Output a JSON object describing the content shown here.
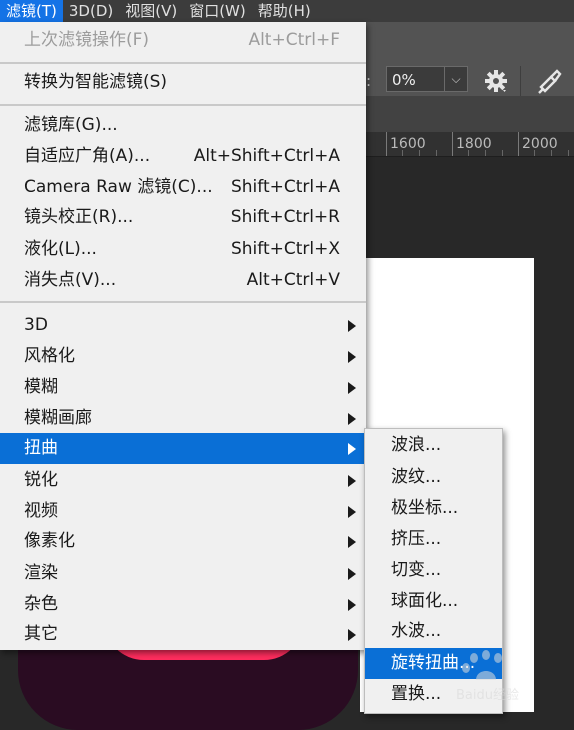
{
  "menubar": {
    "items": [
      {
        "label": "滤镜(T)"
      },
      {
        "label": "3D(D)"
      },
      {
        "label": "视图(V)"
      },
      {
        "label": "窗口(W)"
      },
      {
        "label": "帮助(H)"
      }
    ]
  },
  "options": {
    "opacity_label": ":",
    "opacity_value": "0%"
  },
  "ruler": {
    "labels": [
      "1600",
      "1800",
      "2000"
    ]
  },
  "filter_menu": {
    "last_filter": {
      "label": "上次滤镜操作(F)",
      "shortcut": "Alt+Ctrl+F"
    },
    "smart": {
      "label": "转换为智能滤镜(S)"
    },
    "gallery": {
      "label": "滤镜库(G)..."
    },
    "adaptive_wide": {
      "label": "自适应广角(A)...",
      "shortcut": "Alt+Shift+Ctrl+A"
    },
    "camera_raw": {
      "label": "Camera Raw 滤镜(C)...",
      "shortcut": "Shift+Ctrl+A"
    },
    "lens_correction": {
      "label": "镜头校正(R)...",
      "shortcut": "Shift+Ctrl+R"
    },
    "liquify": {
      "label": "液化(L)...",
      "shortcut": "Shift+Ctrl+X"
    },
    "vanishing_point": {
      "label": "消失点(V)...",
      "shortcut": "Alt+Ctrl+V"
    },
    "submenus": [
      {
        "label": "3D"
      },
      {
        "label": "风格化"
      },
      {
        "label": "模糊"
      },
      {
        "label": "模糊画廊"
      },
      {
        "label": "扭曲"
      },
      {
        "label": "锐化"
      },
      {
        "label": "视频"
      },
      {
        "label": "像素化"
      },
      {
        "label": "渲染"
      },
      {
        "label": "杂色"
      },
      {
        "label": "其它"
      }
    ]
  },
  "distort_submenu": {
    "items": [
      {
        "label": "波浪..."
      },
      {
        "label": "波纹..."
      },
      {
        "label": "极坐标..."
      },
      {
        "label": "挤压..."
      },
      {
        "label": "切变..."
      },
      {
        "label": "球面化..."
      },
      {
        "label": "水波..."
      },
      {
        "label": "旋转扭曲..."
      },
      {
        "label": "置换..."
      }
    ]
  },
  "colors": {
    "menubar_bg": "#3c3c3c",
    "highlight": "#0a6fd6",
    "menu_bg": "#f0f0f0",
    "app_icon_pink": "#ff2d5e"
  },
  "watermark": {
    "text": "Baidu经验"
  }
}
